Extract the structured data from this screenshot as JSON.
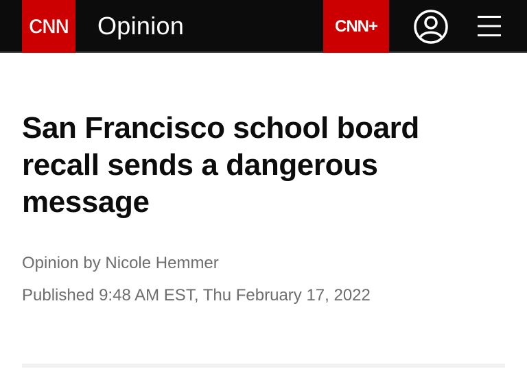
{
  "header": {
    "logo_text": "CNN",
    "section": "Opinion",
    "cnn_plus_text": "CNN+",
    "account_icon": "account-circle-icon",
    "menu_icon": "hamburger-menu-icon",
    "brand_color": "#cc0000",
    "bar_color": "#0c0c0c"
  },
  "article": {
    "headline": "San Francisco school board recall sends a dangerous message",
    "byline": "Opinion by Nicole Hemmer",
    "published": "Published 9:48 AM EST, Thu February 17, 2022"
  }
}
